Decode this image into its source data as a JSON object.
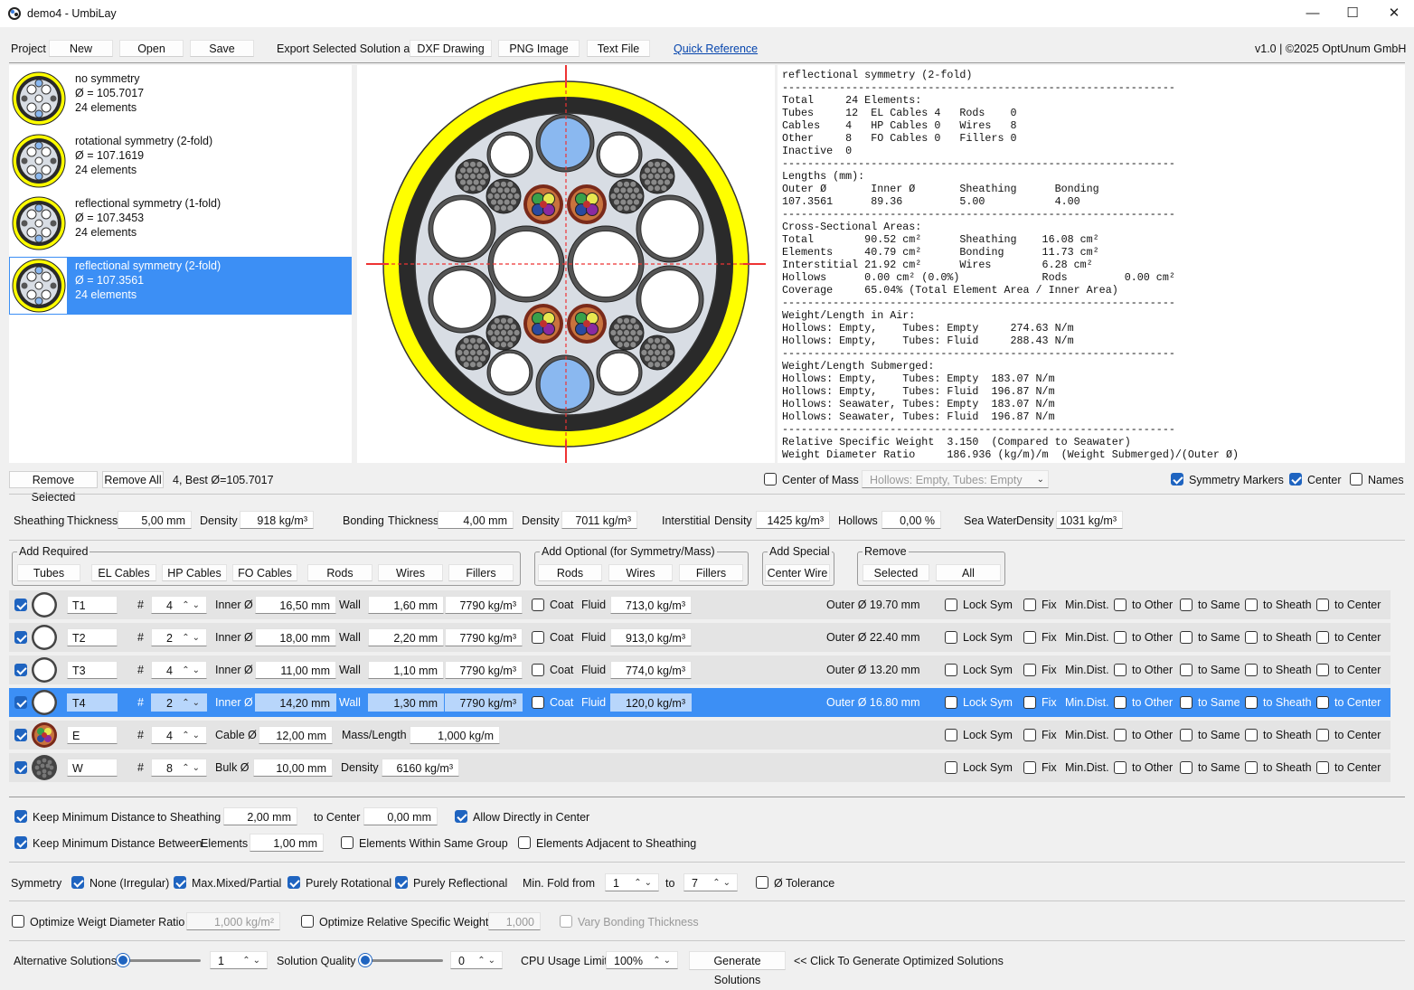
{
  "window": {
    "title": "demo4 - UmbiLay",
    "minimize": "—",
    "maximize": "☐",
    "close": "✕"
  },
  "toolbar": {
    "project_label": "Project",
    "new": "New",
    "open": "Open",
    "save": "Save",
    "export_label": "Export Selected Solution as",
    "dxf": "DXF Drawing",
    "png": "PNG Image",
    "text": "Text File",
    "quick_ref": "Quick Reference",
    "version": "v1.0 | ©2025 OptUnum GmbH"
  },
  "solutions": [
    {
      "name": "no symmetry",
      "diameter": "Ø = 105.7017",
      "elements": "24 elements"
    },
    {
      "name": "rotational symmetry (2-fold)",
      "diameter": "Ø = 107.1619",
      "elements": "24 elements"
    },
    {
      "name": "reflectional symmetry (1-fold)",
      "diameter": "Ø = 107.3453",
      "elements": "24 elements"
    },
    {
      "name": "reflectional symmetry (2-fold)",
      "diameter": "Ø = 107.3561",
      "elements": "24 elements"
    }
  ],
  "report": "reflectional symmetry (2-fold)\n--------------------------------------------------------------\nTotal     24 Elements:\nTubes     12  EL Cables 4   Rods    0\nCables    4   HP Cables 0   Wires   8\nOther     8   FO Cables 0   Fillers 0\nInactive  0\n--------------------------------------------------------------\nLengths (mm):\nOuter Ø       Inner Ø       Sheathing      Bonding\n107.3561      89.36         5.00           4.00\n--------------------------------------------------------------\nCross-Sectional Areas:\nTotal        90.52 cm²      Sheathing    16.08 cm²\nElements     40.79 cm²      Bonding      11.73 cm²\nInterstitial 21.92 cm²      Wires        6.28 cm²\nHollows      0.00 cm² (0.0%)             Rods         0.00 cm²\nCoverage     65.04% (Total Element Area / Inner Area)\n--------------------------------------------------------------\nWeight/Length in Air:\nHollows: Empty,    Tubes: Empty     274.63 N/m\nHollows: Empty,    Tubes: Fluid     288.43 N/m\n--------------------------------------------------------------\nWeight/Length Submerged:\nHollows: Empty,    Tubes: Empty  183.07 N/m\nHollows: Empty,    Tubes: Fluid  196.87 N/m\nHollows: Seawater, Tubes: Empty  183.07 N/m\nHollows: Seawater, Tubes: Fluid  196.87 N/m\n--------------------------------------------------------------\nRelative Specific Weight  3.150  (Compared to Seawater)\nWeight Diameter Ratio     186.936 (kg/m)/m  (Weight Submerged)/(Outer Ø)",
  "list_actions": {
    "remove_selected": "Remove Selected",
    "remove_all": "Remove All",
    "best": "4, Best Ø=105.7017"
  },
  "view_opts": {
    "center_of_mass": "Center of Mass",
    "mass_combo": "Hollows: Empty, Tubes: Empty",
    "symmetry_markers": "Symmetry Markers",
    "center": "Center",
    "names": "Names"
  },
  "props": {
    "sheathing": "Sheathing",
    "thickness": "Thickness",
    "sheathing_thickness": "5,00 mm",
    "density": "Density",
    "sheathing_density": "918 kg/m³",
    "bonding": "Bonding",
    "bonding_thickness": "4,00 mm",
    "bonding_density": "7011 kg/m³",
    "interstitial": "Interstitial",
    "interstitial_density": "1425 kg/m³",
    "hollows": "Hollows",
    "hollows_val": "0,00 %",
    "seawater": "Sea Water",
    "seawater_density": "1031 kg/m³"
  },
  "groups": {
    "required": {
      "label": "Add Required",
      "buttons": [
        "Tubes",
        "EL Cables",
        "HP Cables",
        "FO Cables",
        "Rods",
        "Wires",
        "Fillers"
      ]
    },
    "optional": {
      "label": "Add Optional (for Symmetry/Mass)",
      "buttons": [
        "Rods",
        "Wires",
        "Fillers"
      ]
    },
    "special": {
      "label": "Add Special",
      "buttons": [
        "Center Wire"
      ]
    },
    "remove": {
      "label": "Remove",
      "buttons": [
        "Selected",
        "All"
      ]
    }
  },
  "row_labels": {
    "hash": "#",
    "inner": "Inner Ø",
    "wall": "Wall",
    "coat": "Coat",
    "fluid": "Fluid",
    "cable": "Cable Ø",
    "mass_len": "Mass/Length",
    "bulk": "Bulk Ø",
    "density": "Density",
    "lock": "Lock Sym",
    "fix": "Fix",
    "mindist": "Min.Dist.",
    "to_other": "to Other",
    "to_same": "to Same",
    "to_sheath": "to Sheath",
    "to_center": "to Center"
  },
  "elements": [
    {
      "name": "T1",
      "count": "4",
      "inner": "16,50 mm",
      "wall": "1,60 mm",
      "density": "7790 kg/m³",
      "fluid": "713,0 kg/m³",
      "outer": "Outer Ø 19.70 mm"
    },
    {
      "name": "T2",
      "count": "2",
      "inner": "18,00 mm",
      "wall": "2,20 mm",
      "density": "7790 kg/m³",
      "fluid": "913,0 kg/m³",
      "outer": "Outer Ø 22.40 mm"
    },
    {
      "name": "T3",
      "count": "4",
      "inner": "11,00 mm",
      "wall": "1,10 mm",
      "density": "7790 kg/m³",
      "fluid": "774,0 kg/m³",
      "outer": "Outer Ø 13.20 mm"
    },
    {
      "name": "T4",
      "count": "2",
      "inner": "14,20 mm",
      "wall": "1,30 mm",
      "density": "7790 kg/m³",
      "fluid": "120,0 kg/m³",
      "outer": "Outer Ø 16.80 mm"
    },
    {
      "name": "E",
      "count": "4",
      "cable": "12,00 mm",
      "mass": "1,000 kg/m"
    },
    {
      "name": "W",
      "count": "8",
      "bulk": "10,00 mm",
      "density": "6160 kg/m³"
    }
  ],
  "constraints": {
    "keep_min_dist": "Keep Minimum Distance",
    "to_sheathing": "to Sheathing",
    "sheath_val": "2,00 mm",
    "to_center": "to Center",
    "center_val": "0,00 mm",
    "allow_center": "Allow Directly in Center",
    "keep_min_between": "Keep Minimum Distance Between",
    "elements": "Elements",
    "elements_val": "1,00 mm",
    "same_group": "Elements Within Same Group",
    "adjacent": "Elements Adjacent to Sheathing"
  },
  "symmetry": {
    "label": "Symmetry",
    "none": "None (Irregular)",
    "mixed": "Max.Mixed/Partial",
    "rot": "Purely Rotational",
    "refl": "Purely Reflectional",
    "minfold": "Min. Fold",
    "from": "from",
    "from_val": "1",
    "to": "to",
    "to_val": "7",
    "tol": "Ø Tolerance"
  },
  "optimize": {
    "wdr": "Optimize Weigt Diameter Ratio",
    "wdr_val": "1,000 kg/m²",
    "rsw": "Optimize Relative Specific Weight",
    "rsw_val": "1,000",
    "vary": "Vary Bonding Thickness"
  },
  "bottom": {
    "alt": "Alternative Solutions",
    "alt_val": "1",
    "quality": "Solution Quality",
    "quality_val": "0",
    "cpu": "CPU Usage Limit",
    "cpu_val": "100%",
    "generate": "Generate Solutions",
    "hint": "<< Click To Generate Optimized Solutions"
  },
  "colors": {
    "accent": "#1f64c0",
    "selection": "#3c8ff5",
    "sheath": "#ffff00",
    "bonding": "#2a2a2a"
  }
}
